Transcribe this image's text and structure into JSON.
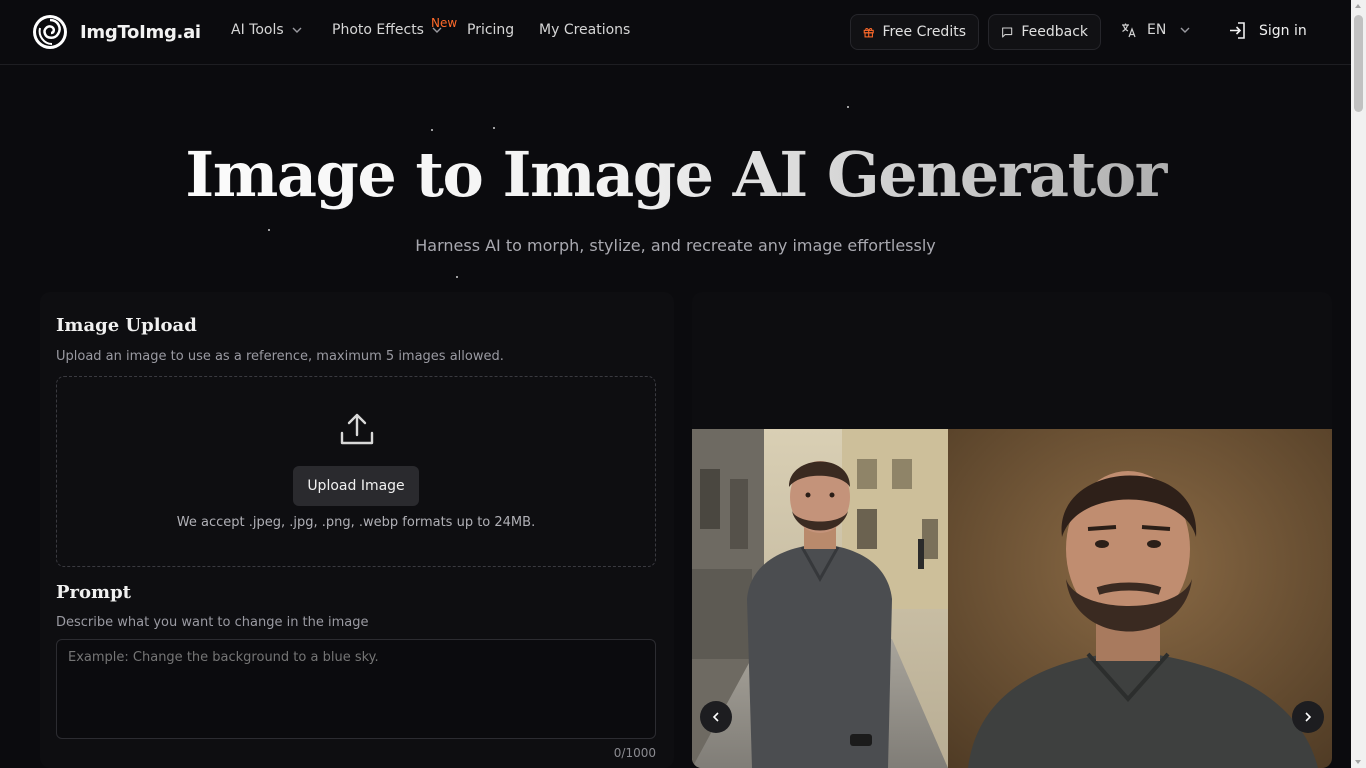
{
  "header": {
    "brand": "ImgToImg.ai",
    "nav": [
      {
        "label": "AI Tools",
        "has_dropdown": true
      },
      {
        "label": "Photo Effects",
        "has_dropdown": true,
        "badge": "New"
      },
      {
        "label": "Pricing",
        "has_dropdown": false
      },
      {
        "label": "My Creations",
        "has_dropdown": false
      }
    ],
    "free_credits": "Free Credits",
    "feedback": "Feedback",
    "language": "EN",
    "sign_in": "Sign in"
  },
  "hero": {
    "title": "Image to Image AI Generator",
    "subtitle": "Harness AI to morph, stylize, and recreate any image effortlessly"
  },
  "upload": {
    "title": "Image Upload",
    "description": "Upload an image to use as a reference, maximum 5 images allowed.",
    "button": "Upload Image",
    "formats": "We accept .jpeg, .jpg, .png, .webp formats up to 24MB."
  },
  "prompt": {
    "title": "Prompt",
    "description": "Describe what you want to change in the image",
    "placeholder": "Example: Change the background to a blue sky.",
    "counter": "0/1000"
  },
  "colors": {
    "background": "#0b0b0e",
    "accent_new": "#ff6a2a",
    "gift_icon": "#ff6a2a"
  },
  "icons": [
    "logo-swirl-icon",
    "chevron-down-icon",
    "gift-icon",
    "message-icon",
    "translate-icon",
    "sign-in-icon",
    "upload-icon",
    "chevron-left-icon",
    "chevron-right-icon"
  ]
}
